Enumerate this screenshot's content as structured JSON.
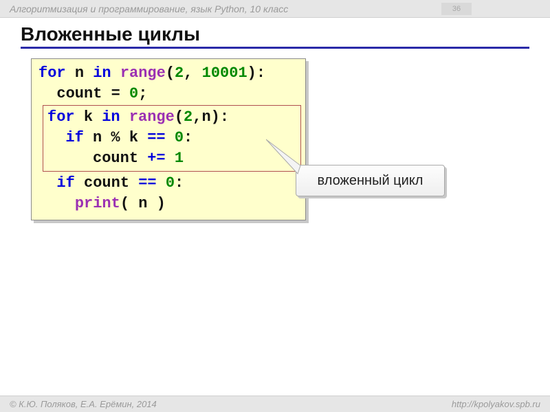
{
  "header": {
    "course": "Алгоритмизация и программирование, язык Python, 10 класс",
    "page": "36"
  },
  "title": "Вложенные циклы",
  "code": {
    "l1": {
      "for": "for",
      "n": "n",
      "in": "in",
      "range": "range",
      "a": "2",
      "b": "10001"
    },
    "l2": {
      "count": "count",
      "eq": "=",
      "zero": "0",
      "semi": ";"
    },
    "l3": {
      "for": "for",
      "k": "k",
      "in": "in",
      "range": "range",
      "a": "2",
      "n": "n"
    },
    "l4": {
      "if": "if",
      "n": "n",
      "mod": "%",
      "k": "k",
      "eqeq": "==",
      "zero": "0"
    },
    "l5": {
      "count": "count",
      "pluseq": "+=",
      "one": "1"
    },
    "l6": {
      "if": "if",
      "count": "count",
      "eqeq": "==",
      "zero": "0"
    },
    "l7": {
      "print": "print",
      "n": "n"
    }
  },
  "callout": "вложенный цикл",
  "footer": {
    "left": "К.Ю. Поляков, Е.А. Ерёмин, 2014",
    "right": "http://kpolyakov.spb.ru"
  }
}
